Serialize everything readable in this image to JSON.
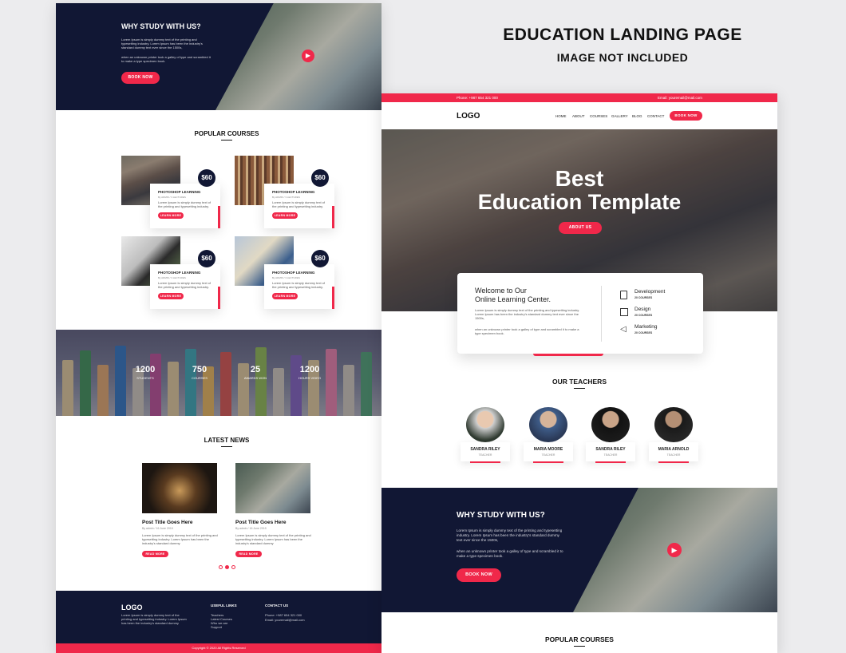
{
  "heading": {
    "title": "EDUCATION LANDING PAGE",
    "subtitle": "IMAGE NOT INCLUDED"
  },
  "left": {
    "why": {
      "title": "WHY STUDY WITH US?",
      "text1": "Lorem Ipsum is simply dummy text of the printing and typesetting industry. Lorem Ipsum has been the industry's standard dummy text ever since the 1500s,",
      "text2": "when an unknown printer took a galley of type and scrambled it to make a type specimen book.",
      "button": "BOOK NOW"
    },
    "popular": {
      "title": "POPULAR COURSES",
      "courses": [
        {
          "price": "$60",
          "name": "PHOTOSHOP LEARNING",
          "by": "By ADMIN / 3 LECTURES",
          "desc": "Lorem Ipsum is simply dummy text of the printing and typesetting industry.",
          "button": "LEARN MORE"
        },
        {
          "price": "$60",
          "name": "PHOTOSHOP LEARNING",
          "by": "By ADMIN / 3 LECTURES",
          "desc": "Lorem Ipsum is simply dummy text of the printing and typesetting industry.",
          "button": "LEARN MORE"
        },
        {
          "price": "$60",
          "name": "PHOTOSHOP LEARNING",
          "by": "By ADMIN / 3 LECTURES",
          "desc": "Lorem Ipsum is simply dummy text of the printing and typesetting industry.",
          "button": "LEARN MORE"
        },
        {
          "price": "$60",
          "name": "PHOTOSHOP LEARNING",
          "by": "By ADMIN / 3 LECTURES",
          "desc": "Lorem Ipsum is simply dummy text of the printing and typesetting industry.",
          "button": "LEARN MORE"
        }
      ]
    },
    "stats": [
      {
        "value": "1200",
        "label": "STUDENTS"
      },
      {
        "value": "750",
        "label": "COURSES"
      },
      {
        "value": "25",
        "label": "AWARDS WON"
      },
      {
        "value": "1200",
        "label": "HOURS VIDEO"
      }
    ],
    "news": {
      "title": "LATEST NEWS",
      "posts": [
        {
          "title": "Post Title Goes Here",
          "meta": "By admin / 16 June 2019",
          "text": "Lorem Ipsum is simply dummy text of the printing and typesetting industry. Lorem Ipsum has been the industry's standard dummy",
          "button": "READ MORE"
        },
        {
          "title": "Post Title Goes Here",
          "meta": "By admin / 16 June 2019",
          "text": "Lorem Ipsum is simply dummy text of the printing and typesetting industry. Lorem Ipsum has been the industry's standard dummy",
          "button": "READ MORE"
        }
      ]
    },
    "footer": {
      "logo": "LOGO",
      "about": "Lorem Ipsum is simply dummy text of the printing and typesetting industry. Lorem Ipsum has been the industry's standard dummy",
      "links_title": "USEFUL LINKS",
      "links": [
        "Teachers",
        "Latest Courses",
        "Who we are",
        "Support"
      ],
      "contact_title": "CONTACT US",
      "phone": "Phone: +987 654 321 000",
      "email": "Email: youremail@mail.com",
      "copyright": "Copyright © 2020 All Rights Reserved"
    }
  },
  "right": {
    "topbar": {
      "phone": "Phone: +987 654 321 000",
      "email": "Email: youremail@mail.com"
    },
    "nav": {
      "logo": "LOGO",
      "items": [
        "HOME",
        "ABOUT",
        "COURSES",
        "GALLERY",
        "BLOG",
        "CONTACT"
      ],
      "button": "BOOK NOW"
    },
    "hero": {
      "line1": "Best",
      "line2": "Education Template",
      "button": "ABOUT US"
    },
    "welcome": {
      "title1": "Welcome to Our",
      "title2": "Online Learning Center.",
      "text1": "Lorem Ipsum is simply dummy text of the printing and typesetting industry. Lorem Ipsum has been the industry's standard dummy text ever since the 1500s,",
      "text2": "when an unknown printer took a galley of type and scrambled it to make a type specimen book.",
      "categories": [
        {
          "name": "Development",
          "count": "20 COURSES",
          "icon": "document-icon"
        },
        {
          "name": "Design",
          "count": "20 COURSES",
          "icon": "image-icon"
        },
        {
          "name": "Marketing",
          "count": "20 COURSES",
          "icon": "megaphone-icon"
        }
      ]
    },
    "teachers": {
      "title": "OUR TEACHERS",
      "list": [
        {
          "name": "SANDRA RILEY",
          "role": "TEACHER"
        },
        {
          "name": "MARIA MOORE",
          "role": "TEACHER"
        },
        {
          "name": "SANDRA RILEY",
          "role": "TEACHER"
        },
        {
          "name": "MARIA ARNOLD",
          "role": "TEACHER"
        }
      ]
    },
    "why": {
      "title": "WHY STUDY WITH US?",
      "text1": "Lorem Ipsum is simply dummy text of the printing and typesetting industry. Lorem Ipsum has been the industry's standard dummy text ever since the 1500s,",
      "text2": "when an unknown printer took a galley of type and scrambled it to make a type specimen book.",
      "button": "BOOK NOW"
    },
    "popular_title": "POPULAR COURSES"
  },
  "colors": {
    "accent": "#f0284a",
    "navy": "#111734",
    "background": "#ececee"
  }
}
